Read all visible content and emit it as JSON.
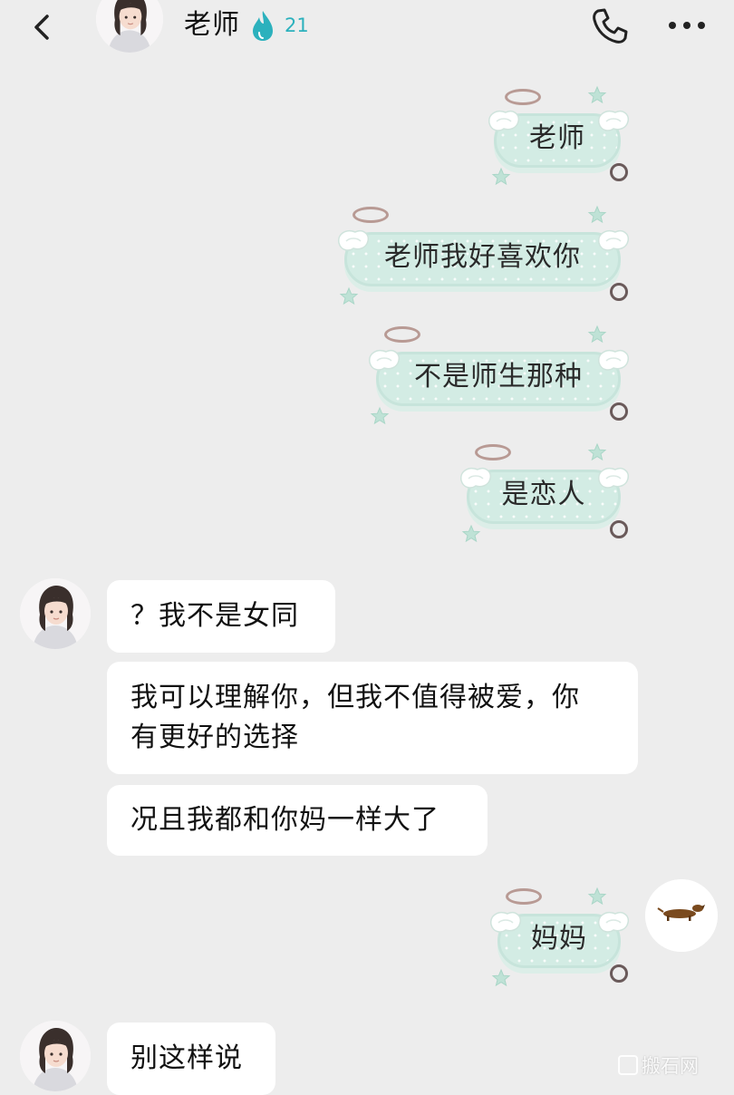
{
  "header": {
    "title": "老师",
    "streak_count": "21",
    "colors": {
      "streak": "#2cb1bd"
    },
    "icons": {
      "back": "chevron-left-icon",
      "streak": "flame-icon",
      "call": "phone-icon",
      "more": "more-icon"
    }
  },
  "messages": [
    {
      "side": "sent",
      "text": "老师"
    },
    {
      "side": "sent",
      "text": "老师我好喜欢你"
    },
    {
      "side": "sent",
      "text": "不是师生那种"
    },
    {
      "side": "sent",
      "text": "是恋人"
    },
    {
      "side": "received",
      "text": "？我不是女同"
    },
    {
      "side": "received",
      "lines": [
        "我可以理解你，但我不值得被爱，你",
        "有更好的选择"
      ]
    },
    {
      "side": "received",
      "text": "况且我都和你妈一样大了"
    },
    {
      "side": "sent",
      "text": "妈妈"
    },
    {
      "side": "received",
      "text": "别这样说"
    }
  ],
  "watermark": "搬石网"
}
